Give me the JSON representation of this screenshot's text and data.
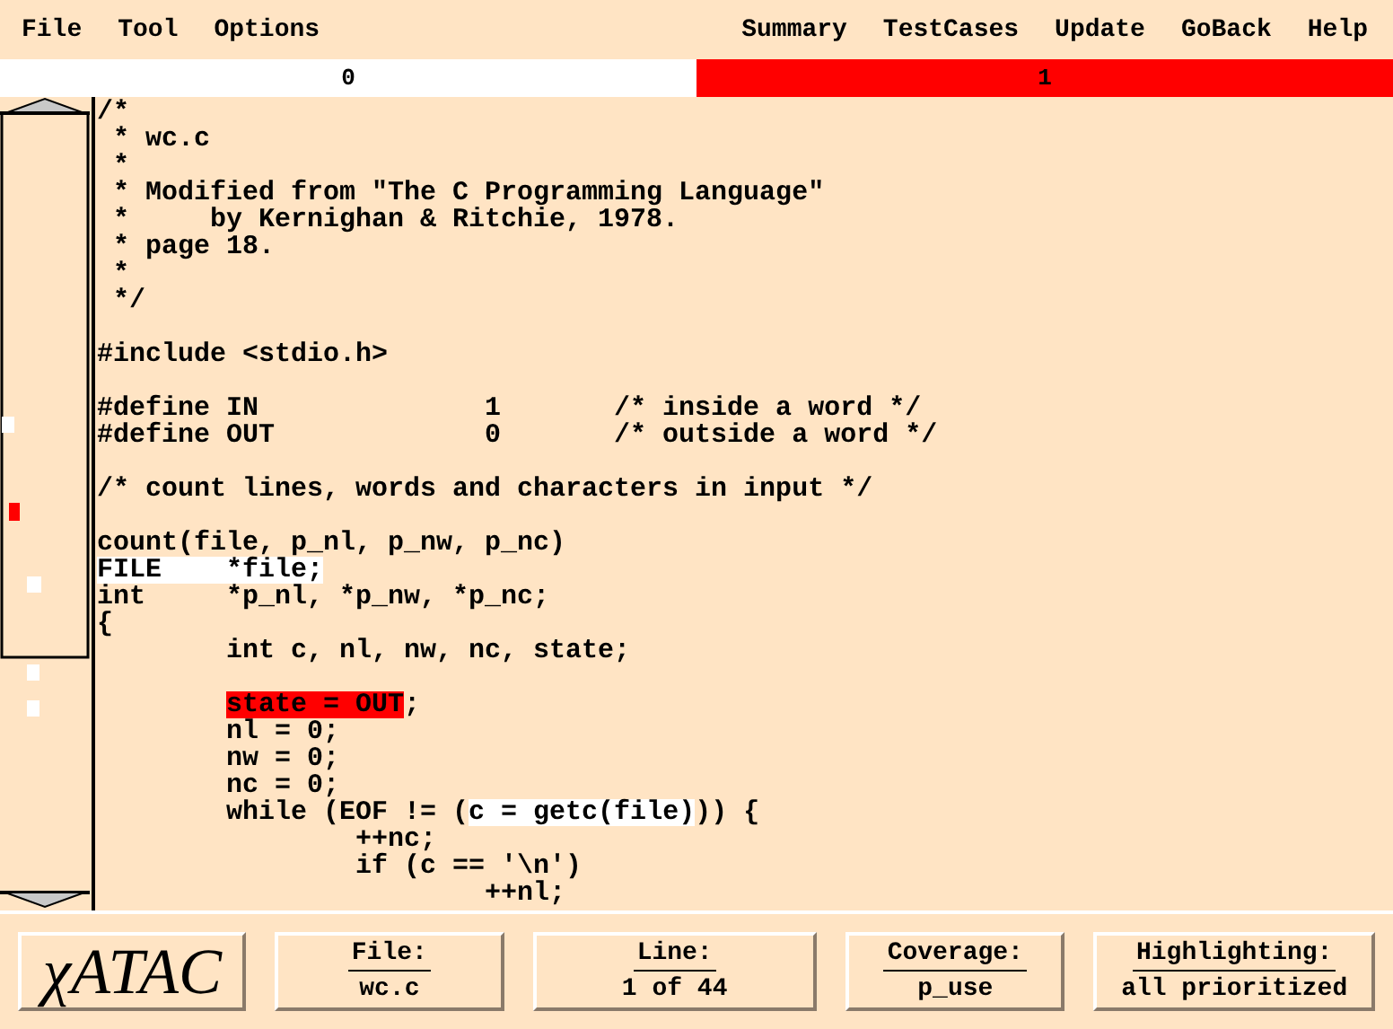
{
  "menu_left": [
    "File",
    "Tool",
    "Options"
  ],
  "menu_right": [
    "Summary",
    "TestCases",
    "Update",
    "GoBack",
    "Help"
  ],
  "coverage_bar": [
    {
      "label": "0",
      "color": "#ffffff"
    },
    {
      "label": "1",
      "color": "#ff0000"
    }
  ],
  "code_lines": [
    {
      "kind": "text",
      "segments": [
        {
          "text": "/*",
          "highlighted": false
        }
      ]
    },
    {
      "kind": "text",
      "segments": [
        {
          "text": " * wc.c",
          "highlighted": false
        }
      ]
    },
    {
      "kind": "text",
      "segments": [
        {
          "text": " *",
          "highlighted": false
        }
      ]
    },
    {
      "kind": "text",
      "segments": [
        {
          "text": " * Modified from \"The C Programming Language\"",
          "highlighted": false
        }
      ]
    },
    {
      "kind": "text",
      "segments": [
        {
          "text": " *     by Kernighan & Ritchie, 1978.",
          "highlighted": false
        }
      ]
    },
    {
      "kind": "text",
      "segments": [
        {
          "text": " * page 18.",
          "highlighted": false
        }
      ]
    },
    {
      "kind": "text",
      "segments": [
        {
          "text": " *",
          "highlighted": false
        }
      ]
    },
    {
      "kind": "text",
      "segments": [
        {
          "text": " */",
          "highlighted": false
        }
      ]
    },
    {
      "kind": "blank"
    },
    {
      "kind": "text",
      "segments": [
        {
          "text": "#include <stdio.h>",
          "highlighted": false
        }
      ]
    },
    {
      "kind": "blank"
    },
    {
      "kind": "text",
      "segments": [
        {
          "text": "#define IN              1       /* inside a word */",
          "highlighted": false
        }
      ]
    },
    {
      "kind": "text",
      "segments": [
        {
          "text": "#define OUT             0       /* outside a word */",
          "highlighted": false
        }
      ]
    },
    {
      "kind": "blank"
    },
    {
      "kind": "text",
      "segments": [
        {
          "text": "/* count lines, words and characters in input */",
          "highlighted": false
        }
      ]
    },
    {
      "kind": "blank"
    },
    {
      "kind": "text",
      "segments": [
        {
          "text": "count(file, p_nl, p_nw, p_nc)",
          "highlighted": false
        }
      ]
    },
    {
      "kind": "text",
      "segments": [
        {
          "text": "FILE    *file;",
          "highlighted": true,
          "color": "#ffffff"
        }
      ]
    },
    {
      "kind": "text",
      "segments": [
        {
          "text": "int     *p_nl, *p_nw, *p_nc;",
          "highlighted": false
        }
      ]
    },
    {
      "kind": "text",
      "segments": [
        {
          "text": "{",
          "highlighted": false
        }
      ]
    },
    {
      "kind": "text",
      "segments": [
        {
          "text": "        int c, nl, nw, nc, state;",
          "highlighted": false
        }
      ]
    },
    {
      "kind": "blank"
    },
    {
      "kind": "text",
      "indented": true,
      "segments": [
        {
          "text": "state = OUT",
          "highlighted": true,
          "color": "#ff0000"
        },
        {
          "text": ";",
          "highlighted": false
        }
      ]
    },
    {
      "kind": "text",
      "segments": [
        {
          "text": "        nl = 0;",
          "highlighted": false
        }
      ]
    },
    {
      "kind": "text",
      "segments": [
        {
          "text": "        nw = 0;",
          "highlighted": false
        }
      ]
    },
    {
      "kind": "text",
      "segments": [
        {
          "text": "        nc = 0;",
          "highlighted": false
        }
      ]
    },
    {
      "kind": "text",
      "segments": [
        {
          "text": "        while (EOF != (",
          "highlighted": false
        },
        {
          "text": "c = getc(file)",
          "highlighted": true,
          "color": "#ffffff"
        },
        {
          "text": ")) {",
          "highlighted": false
        }
      ]
    },
    {
      "kind": "text",
      "segments": [
        {
          "text": "                ++nc;",
          "highlighted": false
        }
      ]
    },
    {
      "kind": "text",
      "segments": [
        {
          "text": "                if (c == '\\n')",
          "highlighted": false
        }
      ]
    },
    {
      "kind": "text",
      "segments": [
        {
          "text": "                        ++nl;",
          "highlighted": false
        }
      ]
    }
  ],
  "status": {
    "logo": "χATAC",
    "panels": [
      {
        "label": "File:",
        "value": "wc.c"
      },
      {
        "label": "Line:",
        "value": "1 of 44"
      },
      {
        "label": "Coverage:",
        "value": "p_use"
      },
      {
        "label": "Highlighting:",
        "value": "all prioritized"
      }
    ]
  }
}
